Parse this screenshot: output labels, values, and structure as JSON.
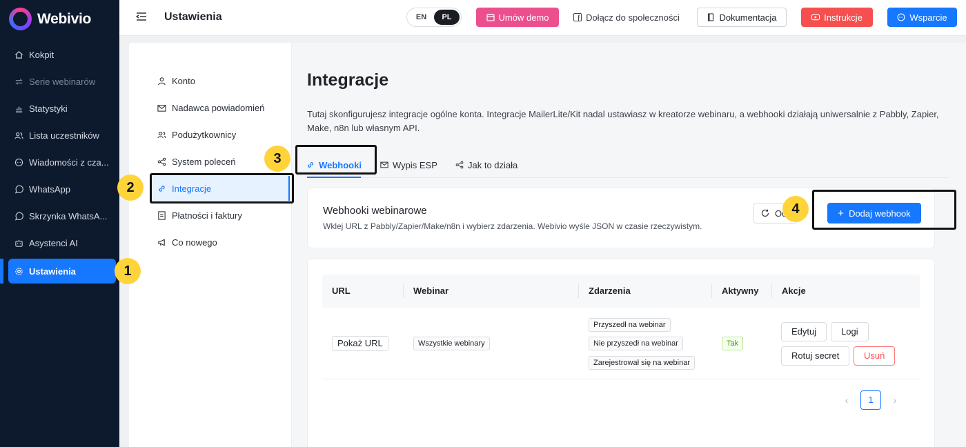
{
  "app": {
    "name": "Webivio"
  },
  "sidebar": {
    "items": [
      {
        "label": "Kokpit",
        "icon": "home-icon"
      },
      {
        "label": "Serie webinarów",
        "icon": "repeat-icon"
      },
      {
        "label": "Statystyki",
        "icon": "chart-icon"
      },
      {
        "label": "Lista uczestników",
        "icon": "users-icon"
      },
      {
        "label": "Wiadomości z cza...",
        "icon": "chat-icon"
      },
      {
        "label": "WhatsApp",
        "icon": "whatsapp-icon"
      },
      {
        "label": "Skrzynka WhatsA...",
        "icon": "whatsapp-icon"
      },
      {
        "label": "Asystenci AI",
        "icon": "robot-icon"
      },
      {
        "label": "Ustawienia",
        "icon": "gear-icon"
      }
    ]
  },
  "header": {
    "title": "Ustawienia",
    "lang": {
      "en": "EN",
      "pl": "PL",
      "active": "PL"
    },
    "demo": "Umów demo",
    "community": "Dołącz do społeczności",
    "docs": "Dokumentacja",
    "instructions": "Instrukcje",
    "support": "Wsparcie"
  },
  "settings_nav": {
    "items": [
      {
        "label": "Konto"
      },
      {
        "label": "Nadawca powiadomień"
      },
      {
        "label": "Podużytkownicy"
      },
      {
        "label": "System poleceń"
      },
      {
        "label": "Integracje"
      },
      {
        "label": "Płatności i faktury"
      },
      {
        "label": "Co nowego"
      }
    ]
  },
  "content": {
    "title": "Integracje",
    "description": "Tutaj skonfigurujesz integracje ogólne konta. Integracje MailerLite/Kit nadal ustawiasz w kreatorze webinaru, a webhooki działają uniwersalnie z Pabbly, Zapier, Make, n8n lub własnym API.",
    "tabs": [
      {
        "label": "Webhooki"
      },
      {
        "label": "Wypis ESP"
      },
      {
        "label": "Jak to działa"
      }
    ]
  },
  "webhooks_panel": {
    "title": "Webhooki webinarowe",
    "subtitle": "Wklej URL z Pabbly/Zapier/Make/n8n i wybierz zdarzenia. Webivio wyśle JSON w czasie rzeczywistym.",
    "refresh_label": "Odśwież",
    "add_label": "Dodaj webhook"
  },
  "table": {
    "columns": [
      "URL",
      "Webinar",
      "Zdarzenia",
      "Aktywny",
      "Akcje"
    ],
    "rows": [
      {
        "url": "Pokaż URL",
        "webinar": "Wszystkie webinary",
        "events": [
          "Przyszedł na webinar",
          "Nie przyszedł na webinar",
          "Zarejestrował się na webinar"
        ],
        "active": "Tak",
        "actions": {
          "edit": "Edytuj",
          "logs": "Logi",
          "rotate": "Rotuj secret",
          "delete": "Usuń"
        }
      }
    ]
  },
  "pagination": {
    "current": "1",
    "prev": "‹",
    "next": "›"
  },
  "annotations": {
    "b1": "1",
    "b2": "2",
    "b3": "3",
    "b4": "4"
  },
  "colors": {
    "primary": "#1677ff",
    "sidebar_bg": "#0d1a2e",
    "demo": "#ec4f8e",
    "instructions": "#f5504f",
    "badge": "#ffd43b"
  }
}
